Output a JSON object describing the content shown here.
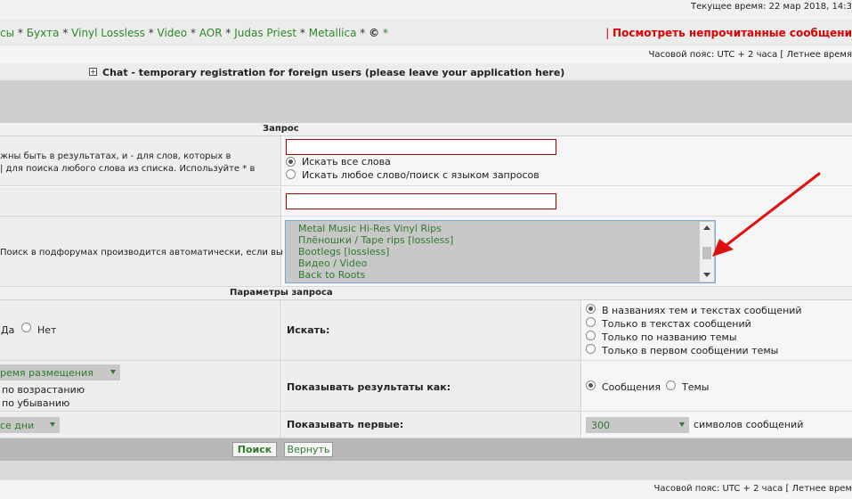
{
  "header": {
    "current_time": "Текущее время: 22 мар 2018, 14:3"
  },
  "nav": {
    "links": [
      "сы",
      "Бухта",
      "Vinyl Lossless",
      "Video",
      "AOR",
      "Judas Priest",
      "Metallica",
      "©"
    ],
    "unread_link": "Посмотреть непрочитанные сообщени"
  },
  "timezone_text": "Часовой пояс: UTC + 2 часа [ Летнее время",
  "timezone_bottom": "Часовой пояс: UTC + 2 часа [ Летнее врем",
  "chat_banner": "Chat - temporary registration for foreign users (please leave your application here)",
  "query": {
    "header": "Запрос",
    "help_line1": "жны быть в результатах, и - для слов, которых в",
    "help_line2": "| для поиска любого слова из списка. Используйте * в",
    "keywords_value": "",
    "option_all": "Искать все слова",
    "option_any": "Искать любое слово/поиск с языком запросов",
    "author_value": "",
    "forums_help": "Поиск в подфорумах производится автоматически, если вы",
    "forums": [
      "Metal Music Hi-Res Vinyl Rips",
      "Плёношки / Tape rips [lossless]",
      "Bootlegs [lossless]",
      "Видео / Video",
      "Back to Roots"
    ]
  },
  "params": {
    "header": "Параметры запроса",
    "subforums_yes": "Да",
    "subforums_no": "Нет",
    "search_in_label": "Искать:",
    "search_in_options": [
      "В названиях тем и текстах сообщений",
      "Только в текстах сообщений",
      "Только по названию темы",
      "Только в первом сообщении темы"
    ],
    "sort_select": "ремя размещения",
    "sort_asc": "по возрастанию",
    "sort_desc": "по убыванию",
    "show_results_label": "Показывать результаты как:",
    "show_posts": "Сообщения",
    "show_topics": "Темы",
    "days_select": "се дни",
    "show_first_label": "Показывать первые:",
    "chars_select": "300",
    "chars_suffix": "символов сообщений"
  },
  "buttons": {
    "search": "Поиск",
    "back": "Вернуть"
  },
  "colors": {
    "link_green": "#2a8a2a",
    "unread_red": "#dd0000",
    "arrow_red": "#e01010"
  }
}
